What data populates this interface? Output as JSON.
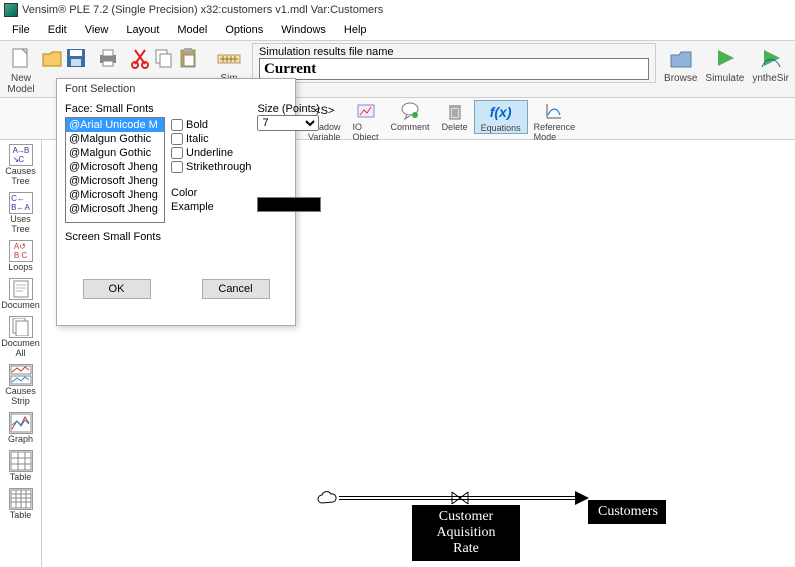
{
  "window": {
    "title": "Vensim® PLE 7.2 (Single Precision) x32:customers v1.mdl Var:Customers"
  },
  "menus": {
    "file": "File",
    "edit": "Edit",
    "view": "View",
    "layout": "Layout",
    "model": "Model",
    "options": "Options",
    "windows": "Windows",
    "help": "Help"
  },
  "toolbar1": {
    "new_model": "New\nModel",
    "sim_setup": "Sim\nSetup",
    "sim_panel_label": "Simulation results file name",
    "sim_panel_value": "Current",
    "browse": "Browse",
    "simulate": "Simulate",
    "synth": "yntheSir"
  },
  "toolbar2": {
    "shadow": "Shadow\nVariable",
    "io": "IO\nObject",
    "comment": "Comment",
    "delete": "Delete",
    "equations": "Equations",
    "refmode": "Reference\nMode"
  },
  "leftbar": {
    "causes_tree": "Causes\nTree",
    "uses_tree": "Uses Tree",
    "loops": "Loops",
    "documen": "Documen",
    "documen_all": "Documen\nAll",
    "causes_strip": "Causes\nStrip",
    "graph": "Graph",
    "table1": "Table",
    "table2": "Table"
  },
  "dialog": {
    "title": "Font Selection",
    "face_label": "Face:",
    "face_value": "Small Fonts",
    "fonts": [
      "@Arial Unicode M",
      "@Malgun Gothic",
      "@Malgun Gothic",
      "@Microsoft Jheng",
      "@Microsoft Jheng",
      "@Microsoft Jheng",
      "@Microsoft Jheng"
    ],
    "size_label": "Size (Points)",
    "size_value": "7",
    "bold": "Bold",
    "italic": "Italic",
    "underline": "Underline",
    "strike": "Strikethrough",
    "color_label": "Color",
    "example": "Example",
    "screen_font": "Screen Small Fonts",
    "ok": "OK",
    "cancel": "Cancel"
  },
  "diagram": {
    "rate": "Customer\nAquisition Rate",
    "stock": "Customers"
  }
}
